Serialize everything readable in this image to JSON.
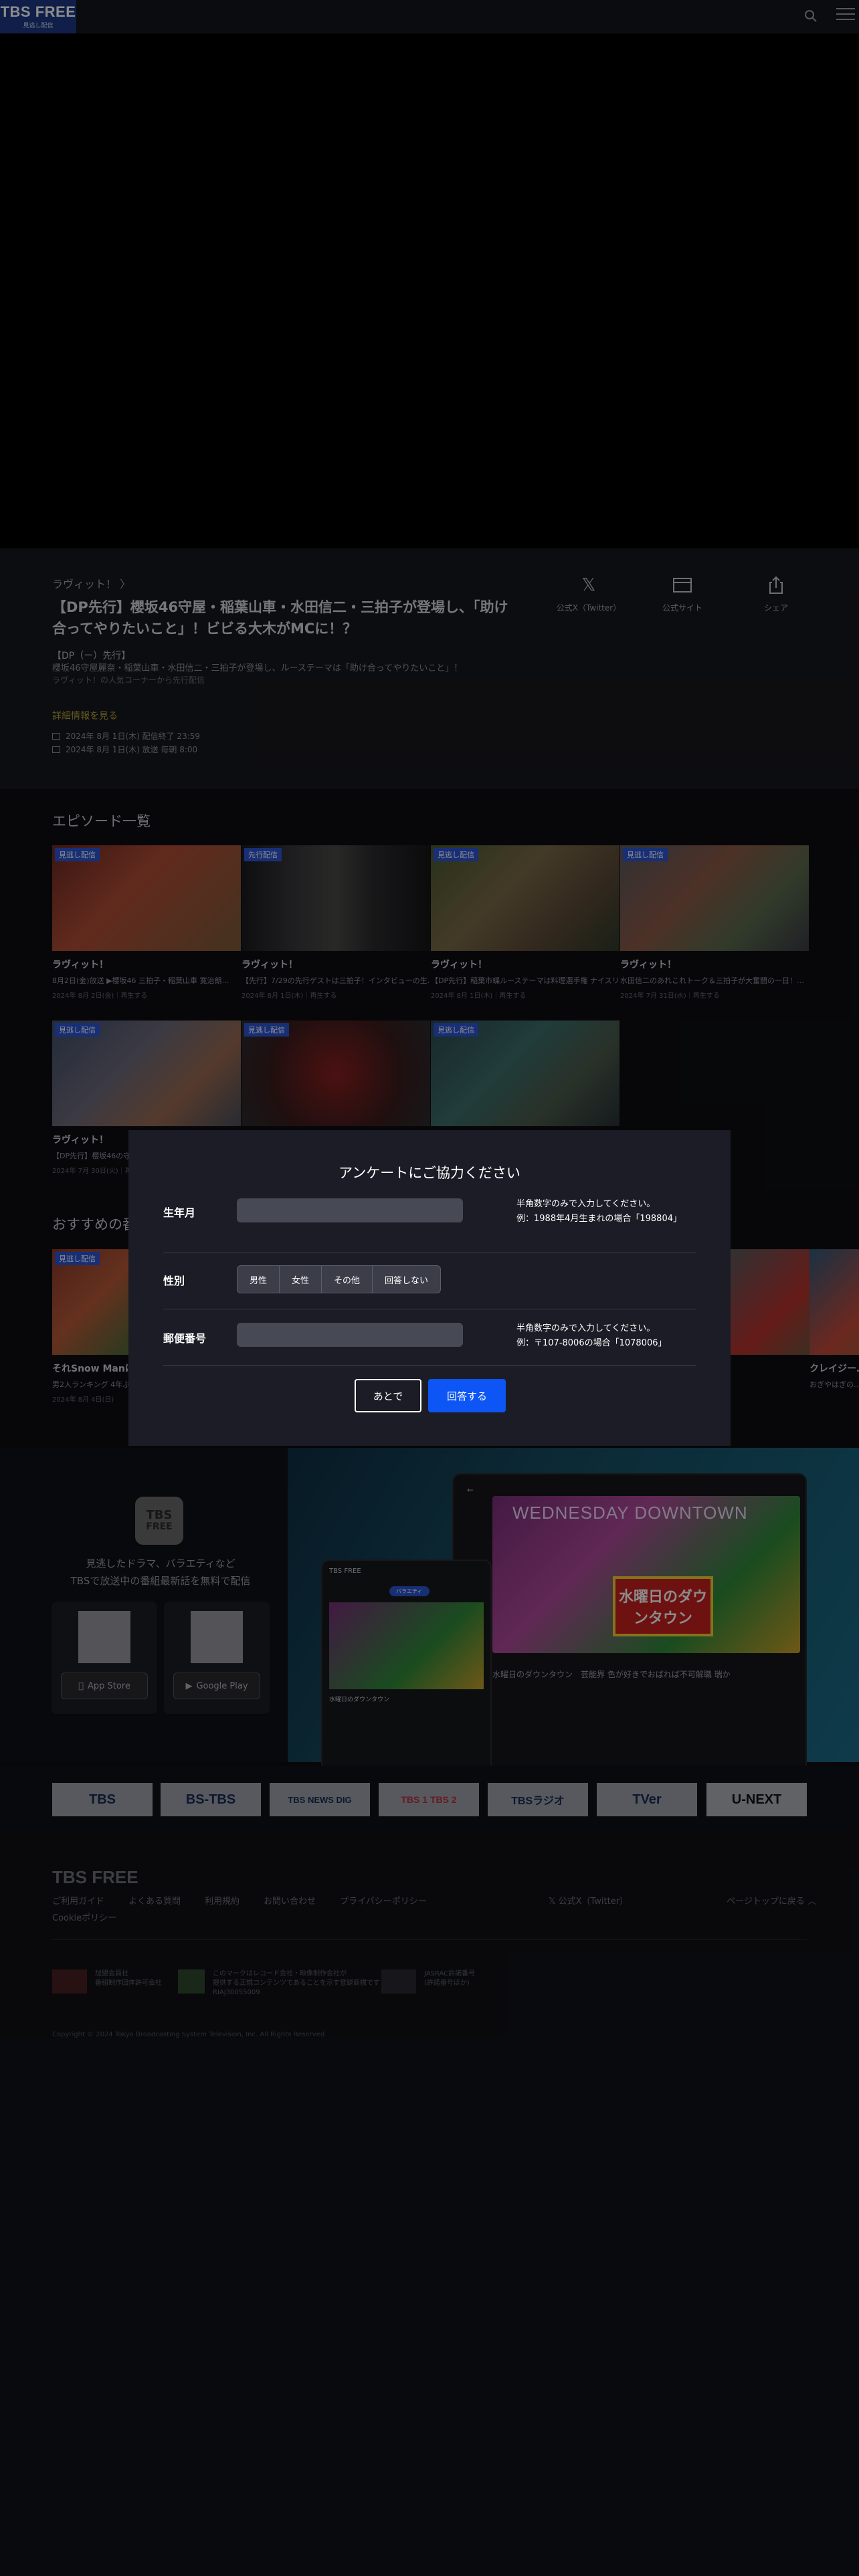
{
  "header": {
    "logo_main": "TBS FREE",
    "logo_sub": "見逃し配信",
    "search_icon": "search-icon",
    "menu_icon": "hamburger-menu-icon"
  },
  "program": {
    "name": "ラヴィット！ 〉",
    "title": "【DP先行】櫻坂46守屋・稲葉山車・水田信二・三拍子が登場し、「助け合ってやりたいこと」！ビビる大木がMCに！？",
    "desc_title": "【DP（ー）先行】",
    "desc_body": "櫻坂46守屋麗奈・稲葉山車・水田信二・三拍子が登場し、ルーステーマは「助け合ってやりたいこと」！",
    "desc_more": "ラヴィット！の人気コーナーから先行配信",
    "detail_link": "詳細情報を見る",
    "meta_1": "2024年 8月 1日(木) 配信終了 23:59",
    "meta_2": "2024年 8月 1日(木) 放送 毎朝 8:00",
    "actions": [
      {
        "label": "公式X（Twitter）",
        "icon": "x-logo-icon"
      },
      {
        "label": "公式サイト",
        "icon": "browser-window-icon"
      },
      {
        "label": "シェア",
        "icon": "share-icon"
      }
    ]
  },
  "episodes": {
    "section_title": "エピソード一覧",
    "items": [
      {
        "badge": "見逃し配信",
        "title": "ラヴィット！",
        "sub": "8月2日(金)放送 ▶櫻坂46 三拍子・稲葉山車 寛治朗…",
        "date": "2024年 8月 2日(金)｜再生する"
      },
      {
        "badge": "先行配信",
        "title": "ラヴィット！",
        "sub": "【先行】7/29の先行ゲストは三拍子！インタビューの生…",
        "date": "2024年 8月 1日(木)｜再生する"
      },
      {
        "badge": "見逃し配信",
        "title": "ラヴィット！",
        "sub": "【DP先行】稲葉市蝶ルーステーマは料理選手権 ナイスリー…",
        "date": "2024年 8月 1日(木)｜再生する"
      },
      {
        "badge": "見逃し配信",
        "title": "ラヴィット！",
        "sub": "水田信二のあれこれトーク＆三拍子が大奮闘の一日！…",
        "date": "2024年 7月 31日(水)｜再生する"
      },
      {
        "badge": "見逃し配信",
        "title": "ラヴィット！",
        "sub": "【DP先行】櫻坂46の守屋・稲葉山車・水田信二…",
        "date": "2024年 7月 30日(火)｜再生する"
      },
      {
        "badge": "見逃し配信",
        "title": "",
        "sub": "",
        "date": ""
      },
      {
        "badge": "見逃し配信",
        "title": "",
        "sub": "",
        "date": ""
      }
    ]
  },
  "recommended": {
    "section_title": "おすすめの番組",
    "items": [
      {
        "badge": "見逃し配信",
        "title": "それSnow Manにや…",
        "sub": "男2人ランキング 4年ぶりに…",
        "date": "2024年 8月 4日(日)"
      },
      {
        "badge": "",
        "title": "",
        "sub": "",
        "date": ""
      },
      {
        "badge": "",
        "title": "クレイジー…",
        "sub": "おぎやはぎの…",
        "date": ""
      }
    ]
  },
  "promo": {
    "app_icon_line1": "TBS",
    "app_icon_line2": "FREE",
    "text": "見逃したドラマ、バラエティなど\nTBSで放送中の番組最新話を無料で配信",
    "appstore": "App Store",
    "googleplay": "Google Play",
    "tablet_banner": "WEDNESDAY DOWNTOWN",
    "tablet_title": "水曜日のダウンタウン",
    "tablet_caption": "水曜日のダウンタウン　芸能界 色が好きでおばれば不可解職 瑞か",
    "phone_header": "TBS FREE",
    "phone_tab_active": "バラエティ",
    "phone_title": "水曜日のダウンタウン"
  },
  "broadcasters": [
    "TBS",
    "BS-TBS",
    "TBS NEWS DIG",
    "TBS 1 TBS 2",
    "TBSラジオ",
    "TVer",
    "U-NEXT"
  ],
  "footer": {
    "logo": "TBS FREE",
    "links": [
      "ご利用ガイド",
      "よくある質問",
      "利用規約",
      "お問い合わせ",
      "プライバシーポリシー",
      "Cookieポリシー"
    ],
    "x_link": "公式X（Twitter）",
    "page_top": "ページトップに戻る",
    "badges": [
      {
        "text": "加盟会員社\n番組制作団体許可会社"
      },
      {
        "text": "このマークはレコード会社・映像制作会社が\n提供する正規コンテンツであることを示す登録商標です\nRIAJ30055009"
      },
      {
        "text": "JASRAC許諾番号\n(許諾番号ほか)"
      }
    ],
    "copyright": "Copyright © 2024 Tokyo Broadcasting System Television, Inc. All Rights Reserved."
  },
  "survey": {
    "title": "アンケートにご協力ください",
    "birth_label": "生年月",
    "birth_help": "半角数字のみで入力してください。\n例：1988年4月生まれの場合「198804」",
    "gender_label": "性別",
    "gender_options": [
      "男性",
      "女性",
      "その他",
      "回答しない"
    ],
    "zip_label": "郵便番号",
    "zip_help": "半角数字のみで入力してください。\n例：〒107-8006の場合「1078006」",
    "later_button": "あとで",
    "answer_button": "回答する"
  },
  "colors": {
    "accent_blue": "#0d55f5",
    "badge_blue": "#2c56d8",
    "background": "#0d0e13"
  }
}
